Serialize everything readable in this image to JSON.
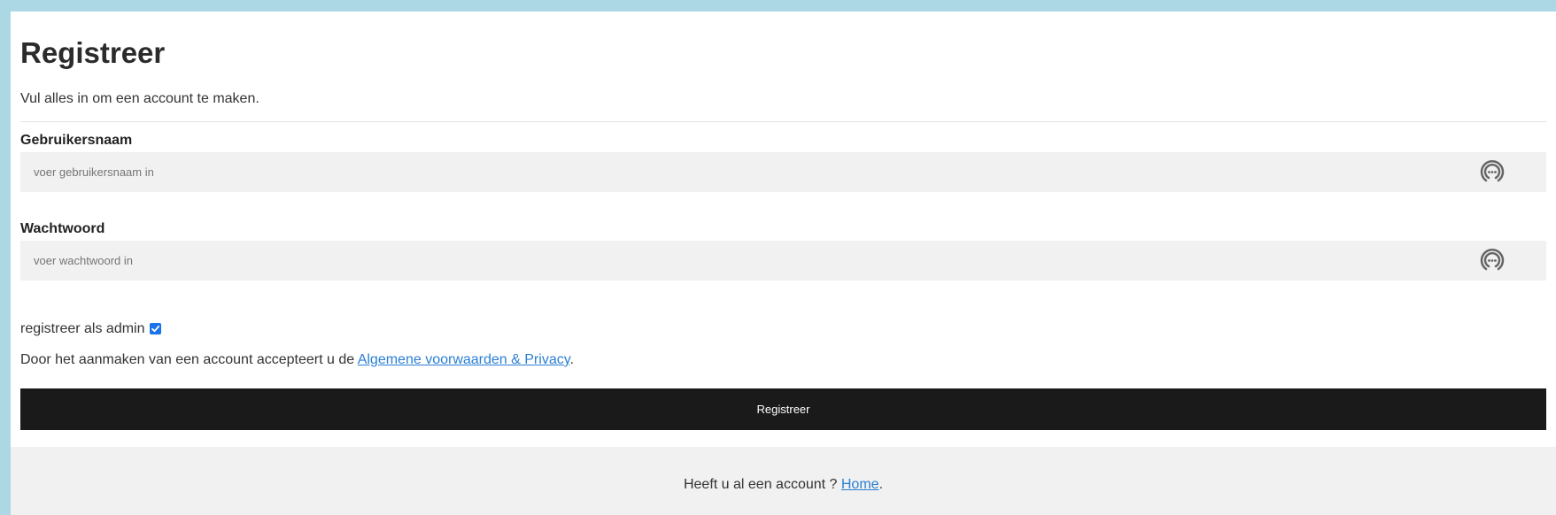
{
  "form": {
    "title": "Registreer",
    "subtitle": "Vul alles in om een account te maken.",
    "username": {
      "label": "Gebruikersnaam",
      "placeholder": "voer gebruikersnaam in",
      "value": ""
    },
    "password": {
      "label": "Wachtwoord",
      "placeholder": "voer wachtwoord in",
      "value": ""
    },
    "admin": {
      "label": "registreer als admin",
      "checked": true
    },
    "terms": {
      "prefix": "Door het aanmaken van een account accepteert u de ",
      "link_label": "Algemene voorwaarden & Privacy",
      "suffix": "."
    },
    "submit_label": "Registreer"
  },
  "footer": {
    "prefix": "Heeft u al een account ? ",
    "link_label": "Home",
    "suffix": "."
  },
  "icons": {
    "password_manager": "password-manager-key-icon"
  },
  "colors": {
    "page_background": "#acd8e6",
    "card_background": "#ffffff",
    "input_background": "#f1f1f1",
    "button_background": "#1a1a1a",
    "link": "#2a7fd4",
    "checkbox": "#1a73e8"
  }
}
